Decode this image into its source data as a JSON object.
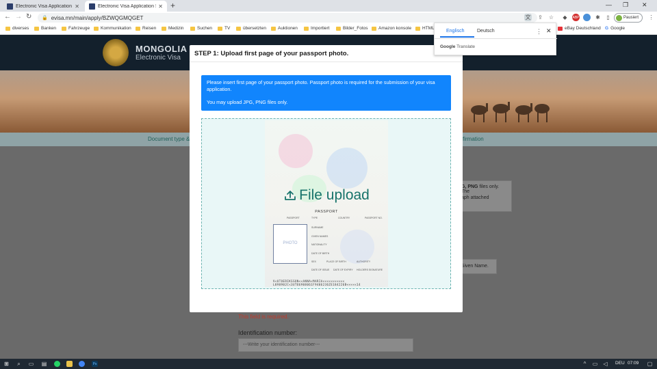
{
  "browser": {
    "tabs": [
      {
        "title": "Electronic Visa Application Syste",
        "active": false
      },
      {
        "title": "Electronic Visa Application Syste",
        "active": true
      }
    ],
    "new_tab_symbol": "+",
    "url": "evisa.mn/main/apply/BZWQGMQGET",
    "profile_label": "Pausiert",
    "bookmarks": [
      "diverses",
      "Banken",
      "Fahrzeuge",
      "Kommunikation",
      "Reisen",
      "Medizin",
      "Suchen",
      "TV",
      "übersetzten",
      "Auktionen",
      "Importiert",
      "Bilder_Fotos",
      "Amazon konsole",
      "HTML",
      "eBay Deutschland",
      "Google"
    ]
  },
  "site": {
    "brand_line1": "MONGOLIA",
    "brand_line2": "Electronic Visa",
    "step_left": "Document type &",
    "step_right": "firmation",
    "side_note_part1": "G, PNG",
    "side_note_part2": " files only. The",
    "side_note_line2": "aph attached",
    "side_note2": "Given Name.",
    "error_text": "This field is required.",
    "id_label": "Identification number:",
    "id_placeholder": "---Write your identification number---"
  },
  "modal": {
    "title": "STEP 1: Upload first page of your passport photo.",
    "alert_line1": "Please insert first page of your passport photo. Passport photo is required for the submission of your visa application.",
    "alert_line2": "You may upload JPG, PNG files only.",
    "upload_label": "File upload",
    "passport": {
      "title": "PASSPORT",
      "labels_row1": [
        "PASSPORT",
        "TYPE",
        "COUNTRY",
        "PASSPORT NO."
      ],
      "fields": [
        "SURNAME",
        "GIVEN NAMES",
        "NATIONALITY",
        "DATE OF BIRTH"
      ],
      "labels_row2": [
        "SEX",
        "PLACE OF BIRTH",
        "AUTHORITY"
      ],
      "labels_row3": [
        "DATE OF ISSUE",
        "DATE OF EXPIRY",
        "HOLDERS SIGNATURE"
      ],
      "photo_label": "PHOTO",
      "mrz1": "V<UTOERIKSSON<<ANNA<MARIA<<<<<<<<<<<",
      "mrz2": "L898902C<3UTO6908061F9406236ZE184226B<<<<<14"
    }
  },
  "translate_popup": {
    "tab_source": "Englisch",
    "tab_target": "Deutsch",
    "brand": "Google",
    "brand_suffix": " Translate"
  },
  "taskbar": {
    "lang": "DEU",
    "time": "07:09"
  }
}
